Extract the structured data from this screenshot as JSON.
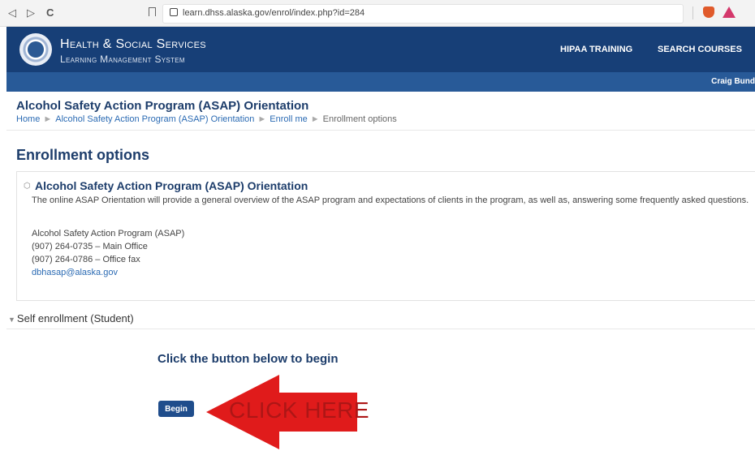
{
  "browser": {
    "url": "learn.dhss.alaska.gov/enrol/index.php?id=284",
    "back_icon": "◁",
    "forward_icon": "▷",
    "reload_icon": "C"
  },
  "header": {
    "brand_line1": "Health & Social Services",
    "brand_line2": "Learning Management System",
    "nav": [
      "HIPAA TRAINING",
      "SEARCH COURSES"
    ],
    "user": "Craig Bund"
  },
  "page": {
    "course_title": "Alcohol Safety Action Program (ASAP) Orientation",
    "breadcrumb": [
      "Home",
      "Alcohol Safety Action Program (ASAP) Orientation",
      "Enroll me",
      "Enrollment options"
    ]
  },
  "enrollment": {
    "heading": "Enrollment options",
    "course_name": "Alcohol Safety Action Program (ASAP) Orientation",
    "summary": "The online ASAP Orientation will provide a general overview of the ASAP program and expectations of clients in the program, as well as, answering some frequently asked questions.",
    "contact_lines": [
      "Alcohol Safety Action Program (ASAP)",
      "(907) 264-0735 – Main Office",
      "(907) 264-0786 – Office fax"
    ],
    "email": "dbhasap@alaska.gov"
  },
  "self_enrol": {
    "header": "Self enrollment (Student)",
    "cta": "Click the button below to begin",
    "button": "Begin",
    "annotation": "CLICK HERE"
  },
  "colors": {
    "header_bg": "#173f77",
    "userbar_bg": "#285a98",
    "button_bg": "#1f4d8c",
    "arrow": "#e01b1b"
  }
}
